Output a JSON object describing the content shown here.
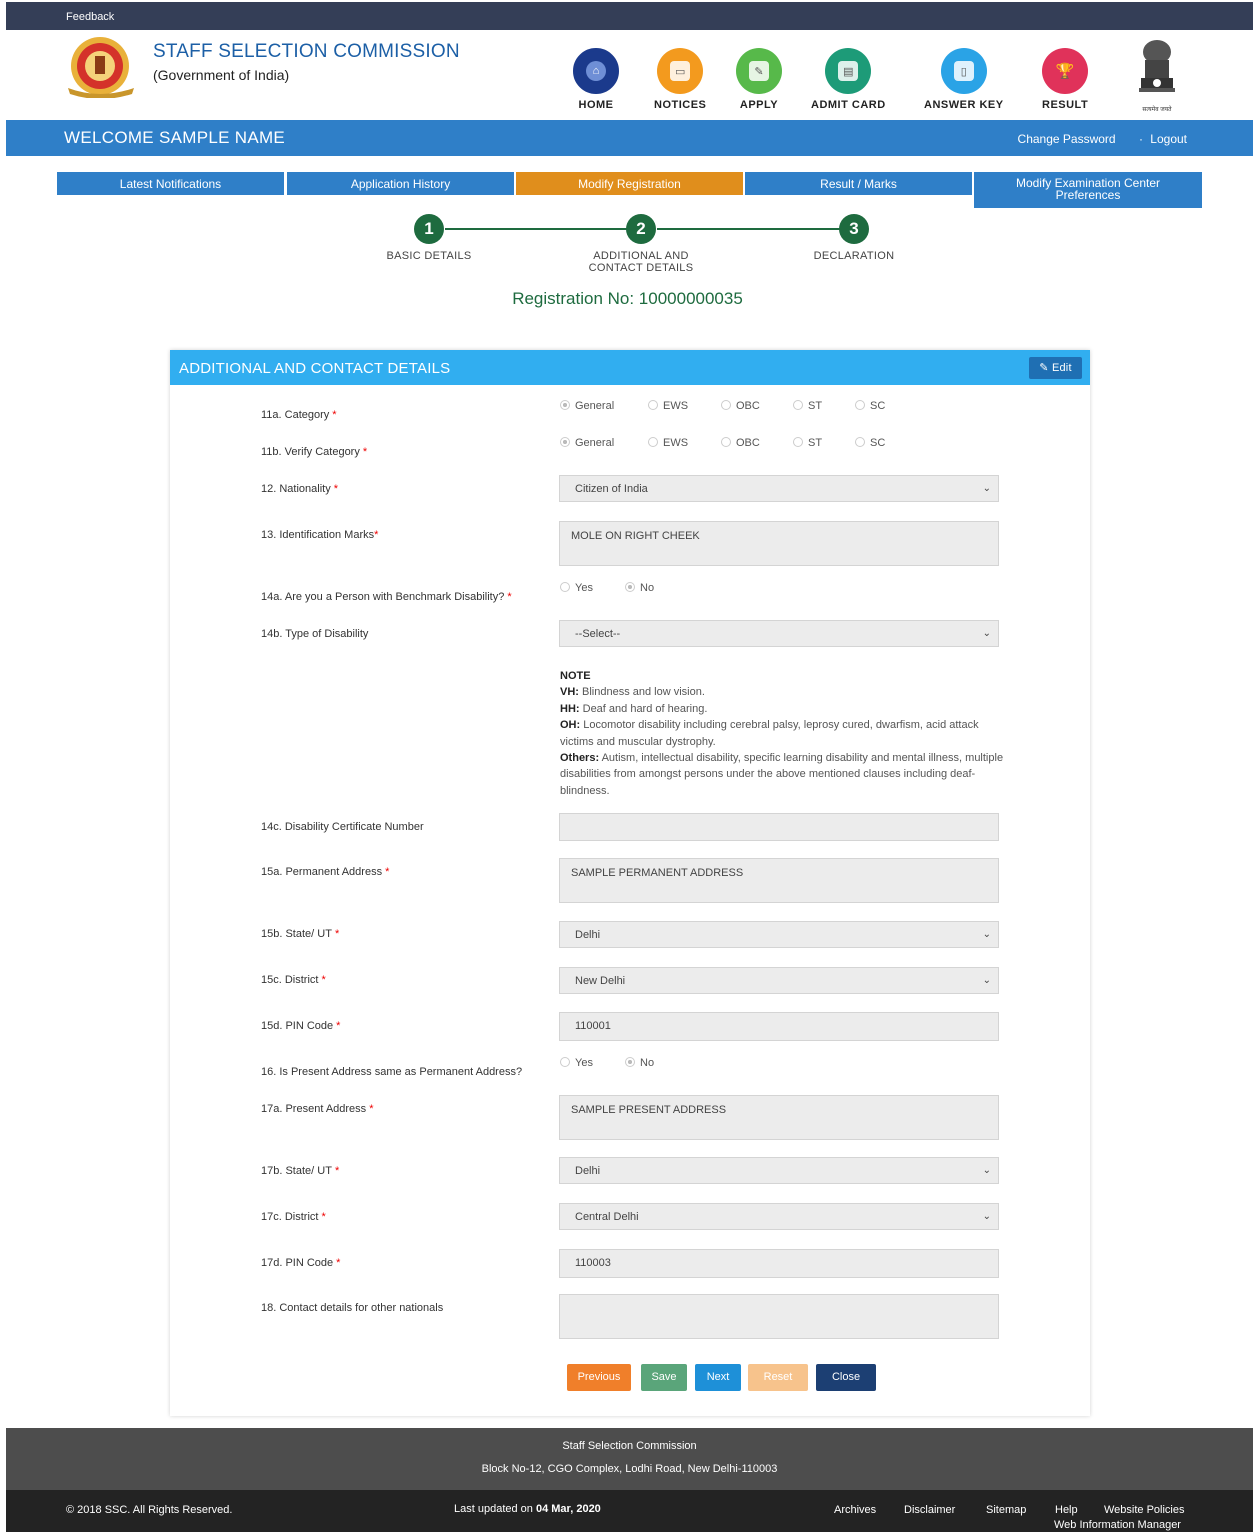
{
  "topbar": {
    "feedback": "Feedback"
  },
  "header": {
    "org_name": "STAFF SELECTION COMMISSION",
    "org_sub": "(Government of India)",
    "nav": [
      {
        "label": "HOME",
        "color": "#1b3a8c",
        "icon": "home-icon"
      },
      {
        "label": "NOTICES",
        "color": "#f39a1e",
        "icon": "notices-icon"
      },
      {
        "label": "APPLY",
        "color": "#57b94a",
        "icon": "apply-icon"
      },
      {
        "label": "ADMIT CARD",
        "color": "#1d9b78",
        "icon": "admit-card-icon"
      },
      {
        "label": "ANSWER KEY",
        "color": "#2aa3e6",
        "icon": "answer-key-icon"
      },
      {
        "label": "RESULT",
        "color": "#e0325a",
        "icon": "trophy-icon"
      }
    ],
    "emblem_caption": "सत्यमेव जयते"
  },
  "welcome": {
    "text": "WELCOME SAMPLE NAME",
    "change_password": "Change Password",
    "logout": "Logout"
  },
  "tabs": [
    {
      "label": "Latest Notifications"
    },
    {
      "label": "Application History"
    },
    {
      "label": "Modify Registration"
    },
    {
      "label": "Result / Marks"
    },
    {
      "label": "Modify Examination Center Preferences"
    }
  ],
  "steps": [
    {
      "num": "1",
      "label": "BASIC DETAILS"
    },
    {
      "num": "2",
      "label": "ADDITIONAL AND CONTACT DETAILS"
    },
    {
      "num": "3",
      "label": "DECLARATION"
    }
  ],
  "registration": "Registration No: 10000000035",
  "panel": {
    "title": "ADDITIONAL AND CONTACT DETAILS",
    "edit": "Edit",
    "category_options": [
      "General",
      "EWS",
      "OBC",
      "ST",
      "SC"
    ],
    "yes_no": [
      "Yes",
      "No"
    ],
    "labels": {
      "category": "11a. Category",
      "verify_category": "11b. Verify Category",
      "nationality": "12. Nationality",
      "identification": "13. Identification Marks",
      "pwbd": "14a. Are you a Person with Benchmark Disability?",
      "disability_type": "14b. Type of Disability",
      "cert_no": "14c. Disability Certificate Number",
      "perm_address": "15a. Permanent Address",
      "perm_state": "15b. State/ UT",
      "perm_district": "15c. District",
      "perm_pin": "15d. PIN Code",
      "same_address": "16. Is Present Address same as Permanent Address?",
      "pres_address": "17a. Present Address",
      "pres_state": "17b. State/ UT",
      "pres_district": "17c. District",
      "pres_pin": "17d. PIN Code",
      "other_nationals": "18. Contact details for other nationals"
    },
    "values": {
      "nationality": "Citizen of India",
      "identification": "MOLE ON RIGHT CHEEK",
      "disability_type": "--Select--",
      "cert_no": "",
      "perm_address": "SAMPLE PERMANENT ADDRESS",
      "perm_state": "Delhi",
      "perm_district": "New Delhi",
      "perm_pin": "110001",
      "pres_address": "SAMPLE PRESENT ADDRESS",
      "pres_state": "Delhi",
      "pres_district": "Central Delhi",
      "pres_pin": "110003",
      "other_nationals": ""
    },
    "note": {
      "title": "NOTE",
      "vh_key": "VH:",
      "vh": "Blindness and low vision.",
      "hh_key": "HH:",
      "hh": "Deaf and hard of hearing.",
      "oh_key": "OH:",
      "oh": "Locomotor disability including cerebral palsy, leprosy cured, dwarfism, acid attack victims and muscular dystrophy.",
      "others_key": "Others:",
      "others": "Autism, intellectual disability, specific learning disability and mental illness, multiple disabilities from amongst persons under the above mentioned clauses including deaf-blindness."
    },
    "buttons": [
      {
        "label": "Previous",
        "color": "#f07f2a"
      },
      {
        "label": "Save",
        "color": "#5aa57a"
      },
      {
        "label": "Next",
        "color": "#1e90d8"
      },
      {
        "label": "Reset",
        "color": "#f7c38c"
      },
      {
        "label": "Close",
        "color": "#1c3f73"
      }
    ]
  },
  "footer": {
    "org": "Staff Selection Commission",
    "address": "Block No-12, CGO Complex, Lodhi Road, New Delhi-110003",
    "copyright": "© 2018 SSC. All Rights Reserved.",
    "updated_prefix": "Last updated on",
    "updated_date": "04 Mar, 2020",
    "links": [
      "Archives",
      "Disclaimer",
      "Sitemap",
      "Help",
      "Website Policies"
    ],
    "manager": "Web Information Manager"
  }
}
